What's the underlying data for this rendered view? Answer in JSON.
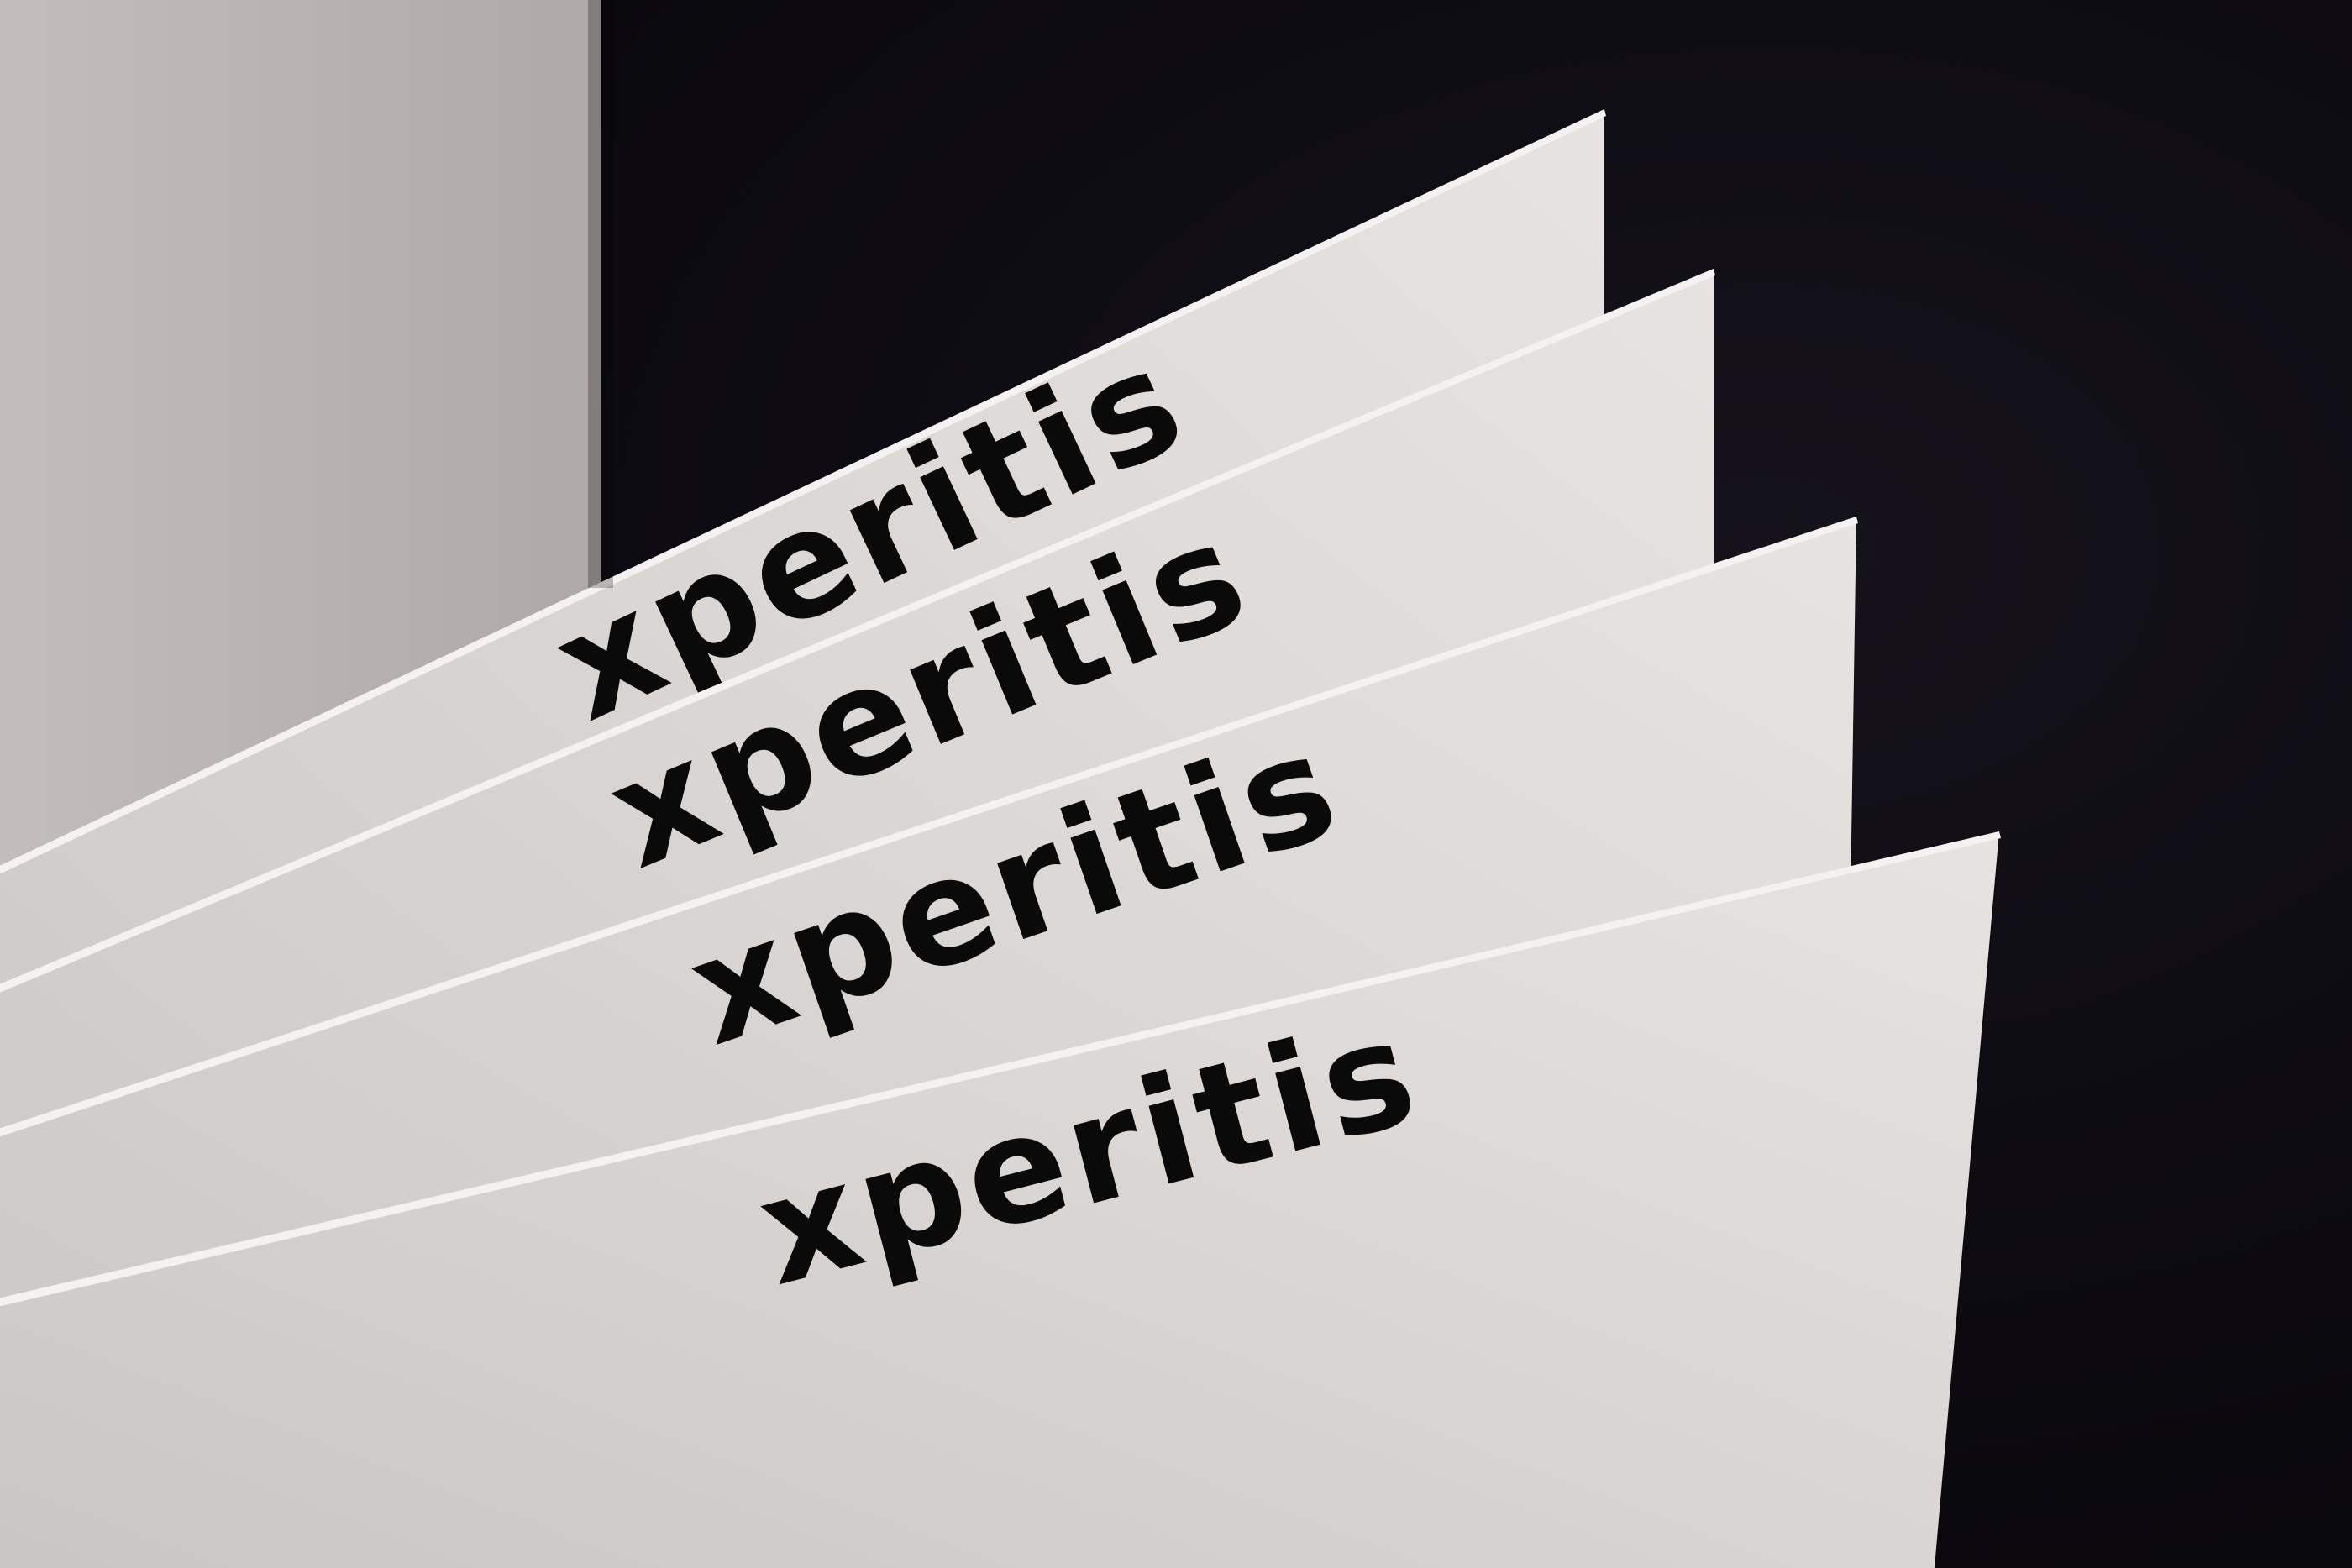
{
  "photo": {
    "colors": {
      "backdrop_dark": "#0c0a10",
      "backdrop_light": "#bcb7b6",
      "paper": "#dedbd9",
      "paper_edge": "#f4f2f0",
      "ink": "#0a0a0a"
    },
    "cards": [
      {
        "wordmark": "xperitis"
      },
      {
        "wordmark": "xperitis"
      },
      {
        "wordmark": "xperitis"
      },
      {
        "wordmark": "xperitis"
      }
    ]
  }
}
